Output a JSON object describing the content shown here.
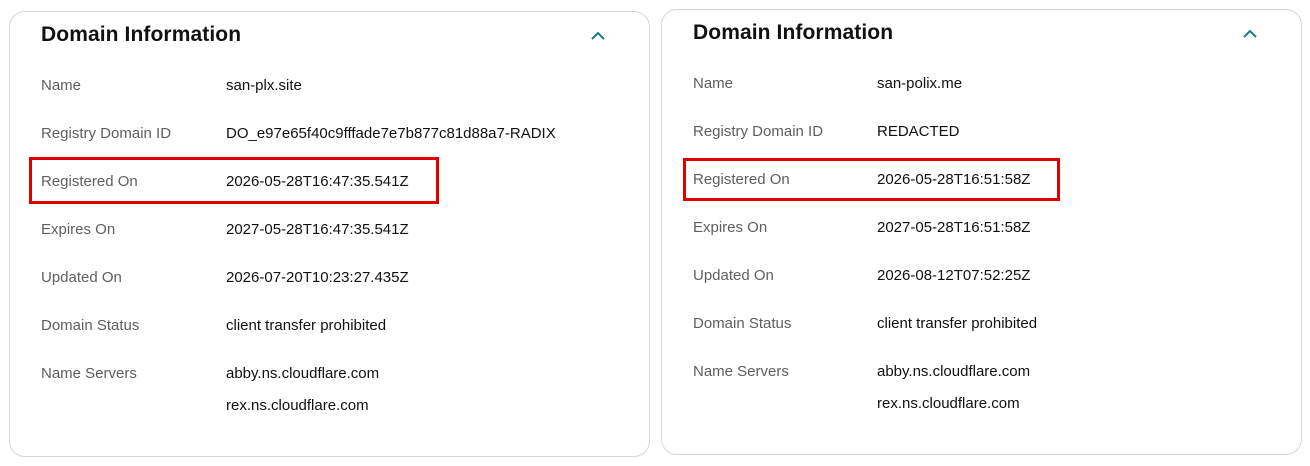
{
  "panels": [
    {
      "title": "Domain Information",
      "rows": {
        "name": {
          "label": "Name",
          "value": "san-plx.site"
        },
        "registry_id": {
          "label": "Registry Domain ID",
          "value": "DO_e97e65f40c9fffade7e7b877c81d88a7-RADIX"
        },
        "registered": {
          "label": "Registered On",
          "value": "2026-05-28T16:47:35.541Z"
        },
        "expires": {
          "label": "Expires On",
          "value": "2027-05-28T16:47:35.541Z"
        },
        "updated": {
          "label": "Updated On",
          "value": "2026-07-20T10:23:27.435Z"
        },
        "status": {
          "label": "Domain Status",
          "value": "client transfer prohibited"
        },
        "nameservers": {
          "label": "Name Servers",
          "values": [
            "abby.ns.cloudflare.com",
            "rex.ns.cloudflare.com"
          ]
        }
      }
    },
    {
      "title": "Domain Information",
      "rows": {
        "name": {
          "label": "Name",
          "value": "san-polix.me"
        },
        "registry_id": {
          "label": "Registry Domain ID",
          "value": "REDACTED"
        },
        "registered": {
          "label": "Registered On",
          "value": "2026-05-28T16:51:58Z"
        },
        "expires": {
          "label": "Expires On",
          "value": "2027-05-28T16:51:58Z"
        },
        "updated": {
          "label": "Updated On",
          "value": "2026-08-12T07:52:25Z"
        },
        "status": {
          "label": "Domain Status",
          "value": "client transfer prohibited"
        },
        "nameservers": {
          "label": "Name Servers",
          "values": [
            "abby.ns.cloudflare.com",
            "rex.ns.cloudflare.com"
          ]
        }
      }
    }
  ],
  "icons": {
    "collapse": "chevron-up-icon"
  },
  "colors": {
    "accent": "#1b7a7a",
    "highlight": "#e00000",
    "label": "#5f5f5f",
    "text": "#111111"
  }
}
